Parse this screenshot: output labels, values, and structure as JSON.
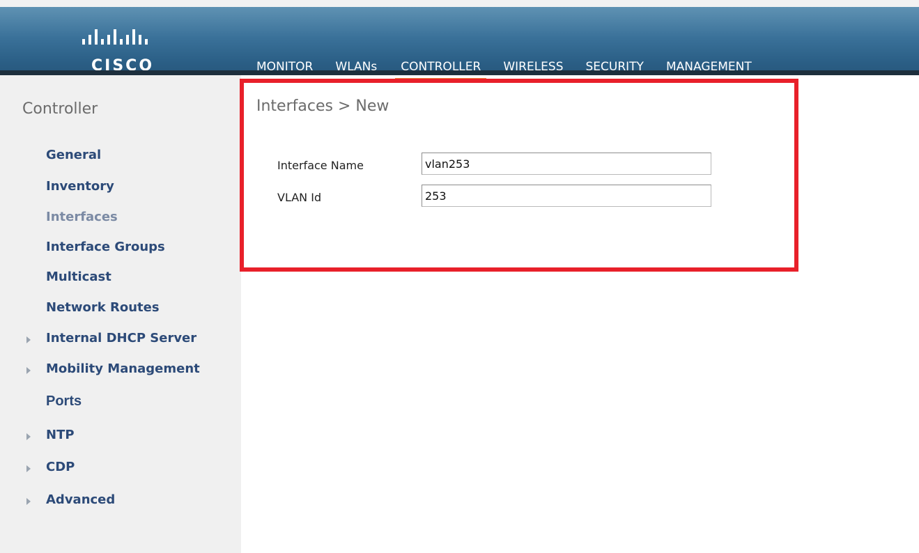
{
  "brand": {
    "logo_text": "CISCO"
  },
  "nav": [
    {
      "label_pre": "",
      "label_u": "M",
      "label_post": "ONITOR"
    },
    {
      "label_pre": "",
      "label_u": "W",
      "label_post": "LANs"
    },
    {
      "label_pre": "",
      "label_u": "C",
      "label_post": "ONTROLLER"
    },
    {
      "label_pre": "W",
      "label_u": "I",
      "label_post": "RELESS"
    },
    {
      "label_pre": "",
      "label_u": "S",
      "label_post": "ECURITY"
    },
    {
      "label_pre": "M",
      "label_u": "A",
      "label_post": "NAGEMENT"
    }
  ],
  "nav_active": "CONTROLLER",
  "sidebar": {
    "title": "Controller",
    "items": [
      {
        "label": "General"
      },
      {
        "label": "Inventory"
      },
      {
        "label": "Interfaces"
      },
      {
        "label": "Interface Groups"
      },
      {
        "label": "Multicast"
      },
      {
        "label": "Network Routes"
      },
      {
        "label": "Internal DHCP Server"
      },
      {
        "label": "Mobility Management"
      },
      {
        "label": "Ports"
      },
      {
        "label": "NTP"
      },
      {
        "label": "CDP"
      },
      {
        "label": "Advanced"
      }
    ]
  },
  "main": {
    "title": "Interfaces > New",
    "fields": [
      {
        "label": "Interface Name",
        "value": "vlan253"
      },
      {
        "label": "VLAN Id",
        "value": "253"
      }
    ]
  },
  "colors": {
    "header": "#3a7199",
    "active_tab": "#e8813a",
    "highlight": "#e8202a",
    "sidebar_link": "#2c4a78"
  }
}
